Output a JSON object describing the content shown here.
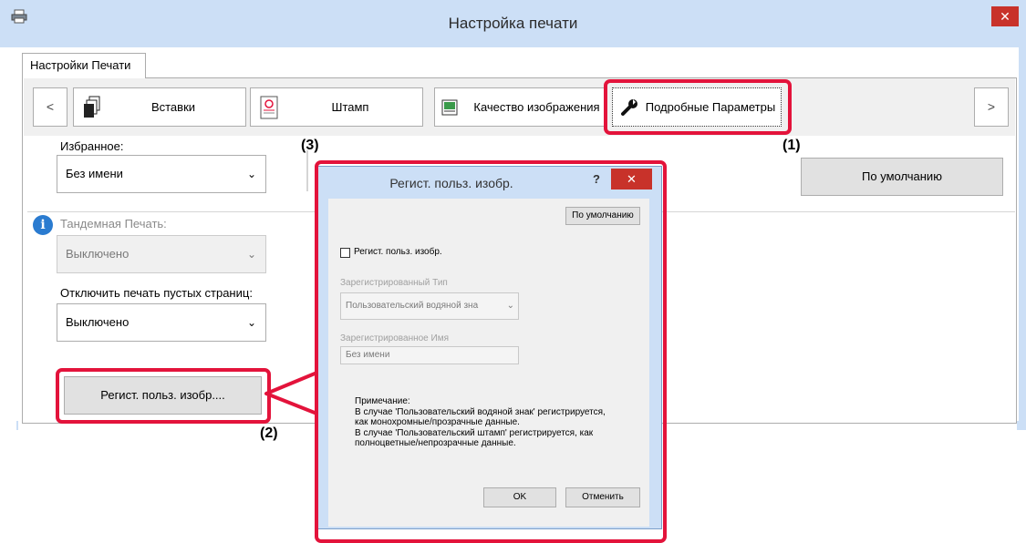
{
  "window": {
    "title": "Настройка печати",
    "close_glyph": "✕"
  },
  "tab": {
    "label": "Настройки Печати"
  },
  "toolbar": {
    "prev_glyph": "<",
    "next_glyph": ">",
    "buttons": [
      {
        "label": "Вставки",
        "icon": "pages-icon"
      },
      {
        "label": "Штамп",
        "icon": "stamp-icon"
      },
      {
        "label": "Качество изображения",
        "icon": "image-quality-icon"
      },
      {
        "label": "Подробные Параметры",
        "icon": "wrench-icon"
      }
    ]
  },
  "left": {
    "favorites_label": "Избранное:",
    "favorites_value": "Без имени",
    "tandem_label": "Тандемная Печать:",
    "tandem_value": "Выключено",
    "blank_label": "Отключить печать пустых страниц:",
    "blank_value": "Выключено",
    "register_button": "Регист. польз. изобр....",
    "info_icon": "info-icon"
  },
  "default_button": "По умолчанию",
  "callouts": {
    "one": "(1)",
    "two": "(2)",
    "three": "(3)"
  },
  "dialog": {
    "title": "Регист. польз. изобр.",
    "help_glyph": "?",
    "close_glyph": "✕",
    "default_button": "По умолчанию",
    "checkbox_label": "Регист. польз. изобр.",
    "checkbox_checked": false,
    "type_label": "Зарегистрированный Тип",
    "type_value": "Пользовательский водяной зна",
    "name_label": "Зарегистрированное Имя",
    "name_value": "Без имени",
    "note_lines": [
      "Примечание:",
      "В случае 'Пользовательский водяной знак' регистрируется,",
      "как монохромные/прозрачные данные.",
      "В случае 'Пользовательский штамп' регистрируется, как",
      "полноцветные/непрозрачные данные."
    ],
    "ok_button": "OK",
    "cancel_button": "Отменить"
  },
  "colors": {
    "accent_red": "#e3133b",
    "titlebar": "#ccdff6",
    "close_red": "#c8322a"
  }
}
